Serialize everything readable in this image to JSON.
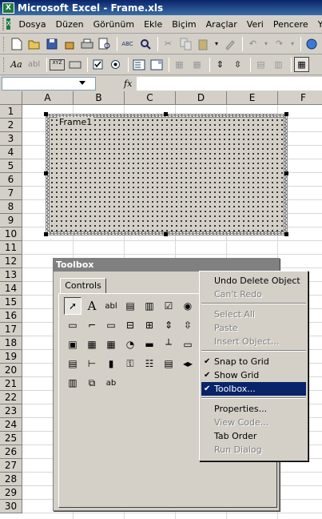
{
  "window": {
    "title": "Microsoft Excel - Frame.xls",
    "app_icon": "X"
  },
  "menu": {
    "items": [
      "Dosya",
      "Düzen",
      "Görünüm",
      "Ekle",
      "Biçim",
      "Araçlar",
      "Veri",
      "Pencere",
      "Y"
    ]
  },
  "toolbar1": {
    "icons": [
      "new-icon",
      "open-icon",
      "save-icon",
      "permission-icon",
      "print-icon",
      "print-preview-icon",
      "spelling-icon",
      "research-icon",
      "cut-icon",
      "copy-icon",
      "paste-icon",
      "format-painter-icon",
      "undo-icon",
      "redo-icon",
      "globe-icon"
    ],
    "glyphs": {
      "spelling": "ABC"
    }
  },
  "toolbar2": {
    "glyphs": {
      "label": "Aa",
      "editbox": "abl",
      "groupbox": "XYZ"
    }
  },
  "formula_bar": {
    "name_box": "",
    "fx_label": "fx",
    "content": ""
  },
  "columns": [
    "A",
    "B",
    "C",
    "D",
    "E",
    "F"
  ],
  "rows": [
    "1",
    "2",
    "3",
    "4",
    "5",
    "6",
    "7",
    "8",
    "9",
    "10",
    "11",
    "12",
    "13",
    "14",
    "15",
    "16",
    "17",
    "18",
    "19",
    "20",
    "21",
    "22",
    "23",
    "24",
    "25",
    "26",
    "27",
    "28",
    "29",
    "30"
  ],
  "frame": {
    "caption": "Frame1"
  },
  "toolbox": {
    "title": "Toolbox",
    "tab": "Controls",
    "tools": [
      {
        "name": "select-pointer-icon",
        "glyph": "➚"
      },
      {
        "name": "label-icon",
        "glyph": "A"
      },
      {
        "name": "textbox-icon",
        "glyph": "abl"
      },
      {
        "name": "combobox-icon",
        "glyph": "▤"
      },
      {
        "name": "listbox-icon",
        "glyph": "▥"
      },
      {
        "name": "checkbox-icon",
        "glyph": "☑"
      },
      {
        "name": "option-button-icon",
        "glyph": "◉"
      },
      {
        "name": "toggle-button-icon",
        "glyph": "▭"
      },
      {
        "name": "frame-icon",
        "glyph": "⌐"
      },
      {
        "name": "command-button-icon",
        "glyph": "▭"
      },
      {
        "name": "tabstrip-icon",
        "glyph": "⊟"
      },
      {
        "name": "multipage-icon",
        "glyph": "⊞"
      },
      {
        "name": "scrollbar-icon",
        "glyph": "⇕"
      },
      {
        "name": "spinbutton-icon",
        "glyph": "⇳"
      },
      {
        "name": "image-icon",
        "glyph": "▣"
      },
      {
        "name": "refedit-icon",
        "glyph": "▦"
      },
      {
        "name": "spreadsheet-icon",
        "glyph": "▦"
      },
      {
        "name": "chart-icon",
        "glyph": "◔"
      },
      {
        "name": "progressbar-icon",
        "glyph": "▬"
      },
      {
        "name": "slider-icon",
        "glyph": "┴"
      },
      {
        "name": "statusbar-icon",
        "glyph": "▭"
      },
      {
        "name": "toolbar-icon",
        "glyph": "▤"
      },
      {
        "name": "treeview-icon",
        "glyph": "⊢"
      },
      {
        "name": "chart-control-icon",
        "glyph": "▮"
      },
      {
        "name": "key-icon",
        "glyph": "⚿"
      },
      {
        "name": "calendar-icon",
        "glyph": "☷"
      },
      {
        "name": "listview-icon",
        "glyph": "▤"
      },
      {
        "name": "updown-icon",
        "glyph": "◂▸"
      },
      {
        "name": "grid-icon",
        "glyph": "▥"
      },
      {
        "name": "window-icon",
        "glyph": "⧉"
      },
      {
        "name": "edit-text-icon",
        "glyph": "ab"
      }
    ]
  },
  "context_menu": {
    "items": [
      {
        "label": "Undo Delete Object",
        "state": "normal",
        "check": ""
      },
      {
        "label": "Can't Redo",
        "state": "disabled",
        "check": ""
      },
      {
        "label": "Select All",
        "state": "disabled",
        "check": ""
      },
      {
        "label": "Paste",
        "state": "disabled",
        "check": ""
      },
      {
        "label": "Insert Object...",
        "state": "disabled",
        "check": ""
      },
      {
        "label": "Snap to Grid",
        "state": "normal",
        "check": "✔"
      },
      {
        "label": "Show Grid",
        "state": "normal",
        "check": "✔"
      },
      {
        "label": "Toolbox...",
        "state": "highlight",
        "check": "✔"
      },
      {
        "label": "Properties...",
        "state": "normal",
        "check": ""
      },
      {
        "label": "View Code...",
        "state": "disabled",
        "check": ""
      },
      {
        "label": "Tab Order",
        "state": "normal",
        "check": ""
      },
      {
        "label": "Run Dialog",
        "state": "disabled",
        "check": ""
      }
    ]
  }
}
